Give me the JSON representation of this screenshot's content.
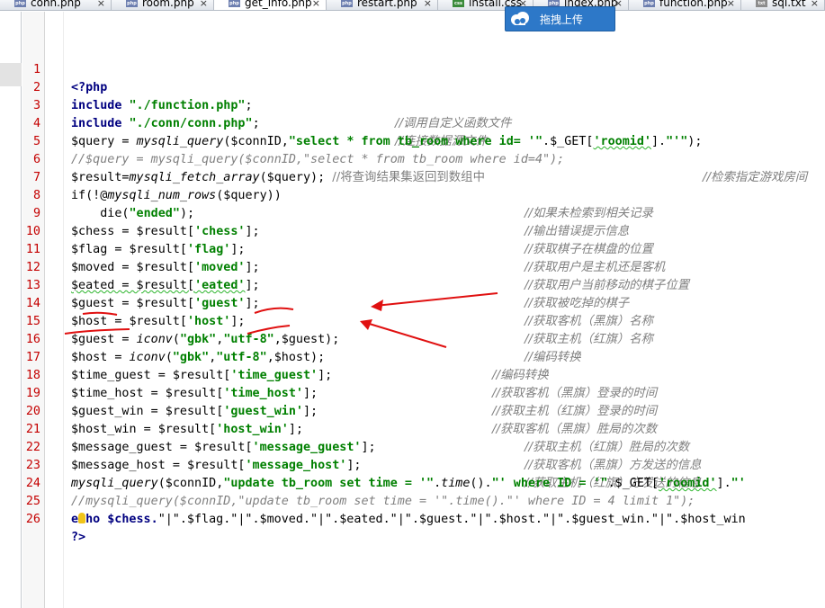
{
  "tabs": [
    {
      "label": "conn.php",
      "type": "php",
      "active": false
    },
    {
      "label": "room.php",
      "type": "php",
      "active": false
    },
    {
      "label": "get_info.php",
      "type": "php",
      "active": true
    },
    {
      "label": "restart.php",
      "type": "php",
      "active": false
    },
    {
      "label": "install.css",
      "type": "css",
      "active": false
    },
    {
      "label": "index.php",
      "type": "php",
      "active": false
    },
    {
      "label": "function.php",
      "type": "php",
      "active": false
    },
    {
      "label": "sql.txt",
      "type": "txt",
      "active": false
    }
  ],
  "tab_close_glyph": "×",
  "file_type_badges": {
    "php": "php",
    "css": "css",
    "txt": "txt"
  },
  "upload_badge": {
    "label": "拖拽上传",
    "icon": "cloud-icon"
  },
  "line_numbers": [
    "1",
    "2",
    "3",
    "4",
    "5",
    "6",
    "7",
    "8",
    "9",
    "10",
    "11",
    "12",
    "13",
    "14",
    "15",
    "16",
    "17",
    "18",
    "19",
    "20",
    "21",
    "22",
    "23",
    "24",
    "25",
    "26"
  ],
  "code": {
    "l1": {
      "open": "<?php"
    },
    "l2": {
      "kw": "include",
      "str": "\"./function.php\"",
      "end": ";",
      "comment": "//调用自定义函数文件"
    },
    "l3": {
      "kw": "include",
      "str": "\"./conn/conn.php\"",
      "end": ";",
      "comment": "//连接数据源文件"
    },
    "l4": {
      "a": "$query = ",
      "fn": "mysqli_query",
      "b": "($connID,",
      "str1": "\"select * from tb_room where id= '\"",
      "c": ".$_GET[",
      "str2": "'roomid'",
      "d": "].",
      "str3": "\"'\"",
      "e": ");"
    },
    "l5": {
      "comment": "//$query = mysqli_query($connID,\"select * from tb_room where id=4\");",
      "comment2": "//检索指定游戏房间"
    },
    "l6": {
      "a": "$result=",
      "fn": "mysqli_fetch_array",
      "b": "($query); ",
      "comment": "//将查询结果集返回到数组中"
    },
    "l7": {
      "a": "if(!@",
      "fn": "mysqli_num_rows",
      "b": "($query))",
      "comment": "//如果未检索到相关记录"
    },
    "l8": {
      "a": "    die(",
      "str": "\"ended\"",
      "b": ");",
      "comment": "//输出错误提示信息"
    },
    "l9": {
      "a": "$chess = $result[",
      "str": "'chess'",
      "b": "];",
      "comment": "//获取棋子在棋盘的位置"
    },
    "l10": {
      "a": "$flag = $result[",
      "str": "'flag'",
      "b": "];",
      "comment": "//获取用户是主机还是客机"
    },
    "l11": {
      "a": "$moved = $result[",
      "str": "'moved'",
      "b": "];",
      "comment": "//获取用户当前移动的棋子位置"
    },
    "l12": {
      "a": "$eated = $result[",
      "str": "'eated'",
      "b": "];",
      "comment": "//获取被吃掉的棋子"
    },
    "l13": {
      "a": "$guest = $result[",
      "str": "'guest'",
      "b": "];",
      "comment": "//获取客机（黑旗）名称"
    },
    "l14": {
      "a": "$host = $result[",
      "str": "'host'",
      "b": "];",
      "comment": "//获取主机（红旗）名称"
    },
    "l15": {
      "a": "$guest = ",
      "fn": "iconv",
      "b": "(",
      "str1": "\"gbk\"",
      "c": ",",
      "str2": "\"utf-8\"",
      "d": ",$guest);",
      "comment": "//编码转换"
    },
    "l16": {
      "a": "$host = ",
      "fn": "iconv",
      "b": "(",
      "str1": "\"gbk\"",
      "c": ",",
      "str2": "\"utf-8\"",
      "d": ",$host);",
      "comment": "//编码转换"
    },
    "l17": {
      "a": "$time_guest = $result[",
      "str": "'time_guest'",
      "b": "];",
      "comment": "//获取客机（黑旗）登录的时间"
    },
    "l18": {
      "a": "$time_host = $result[",
      "str": "'time_host'",
      "b": "];",
      "comment": "//获取主机（红旗）登录的时间"
    },
    "l19": {
      "a": "$guest_win = $result[",
      "str": "'guest_win'",
      "b": "];",
      "comment": "//获取客机（黑旗）胜局的次数"
    },
    "l20": {
      "a": "$host_win = $result[",
      "str": "'host_win'",
      "b": "];",
      "comment": "//获取主机（红旗）胜局的次数"
    },
    "l21": {
      "a": "$message_guest = $result[",
      "str": "'message_guest'",
      "b": "];",
      "comment": "//获取客机（黑旗）方发送的信息"
    },
    "l22": {
      "a": "$message_host = $result[",
      "str": "'message_host'",
      "b": "];",
      "comment": "//获取主机（红旗）方发送的信息"
    },
    "l23": {
      "fn": "mysqli_query",
      "a": "($connID,",
      "str1": "\"update tb_room set time = '\"",
      "b": ".",
      "fn2": "time",
      "c": "().",
      "str2": "\"' where ID = '\"",
      "d": ".$_GET[",
      "str3": "'roomid'",
      "e": "].",
      "str4": "\"'"
    },
    "l24": {
      "comment": "//mysqli_query($connID,\"update tb_room set time = '\".time().\"' where ID = 4 limit 1\");"
    },
    "l25": {
      "pre": "e",
      "post": "ho $chess.",
      "rest": "\"|\".$flag.\"|\".$moved.\"|\".$eated.\"|\".$guest.\"|\".$host.\"|\".$guest_win.\"|\".$host_win"
    },
    "l26": {
      "close": "?>"
    }
  },
  "colors": {
    "keyword": "#000080",
    "string": "#008000",
    "comment": "#808080",
    "line_number": "#c40000",
    "annotation": "#e01010",
    "upload_badge": "#2d78c8"
  }
}
